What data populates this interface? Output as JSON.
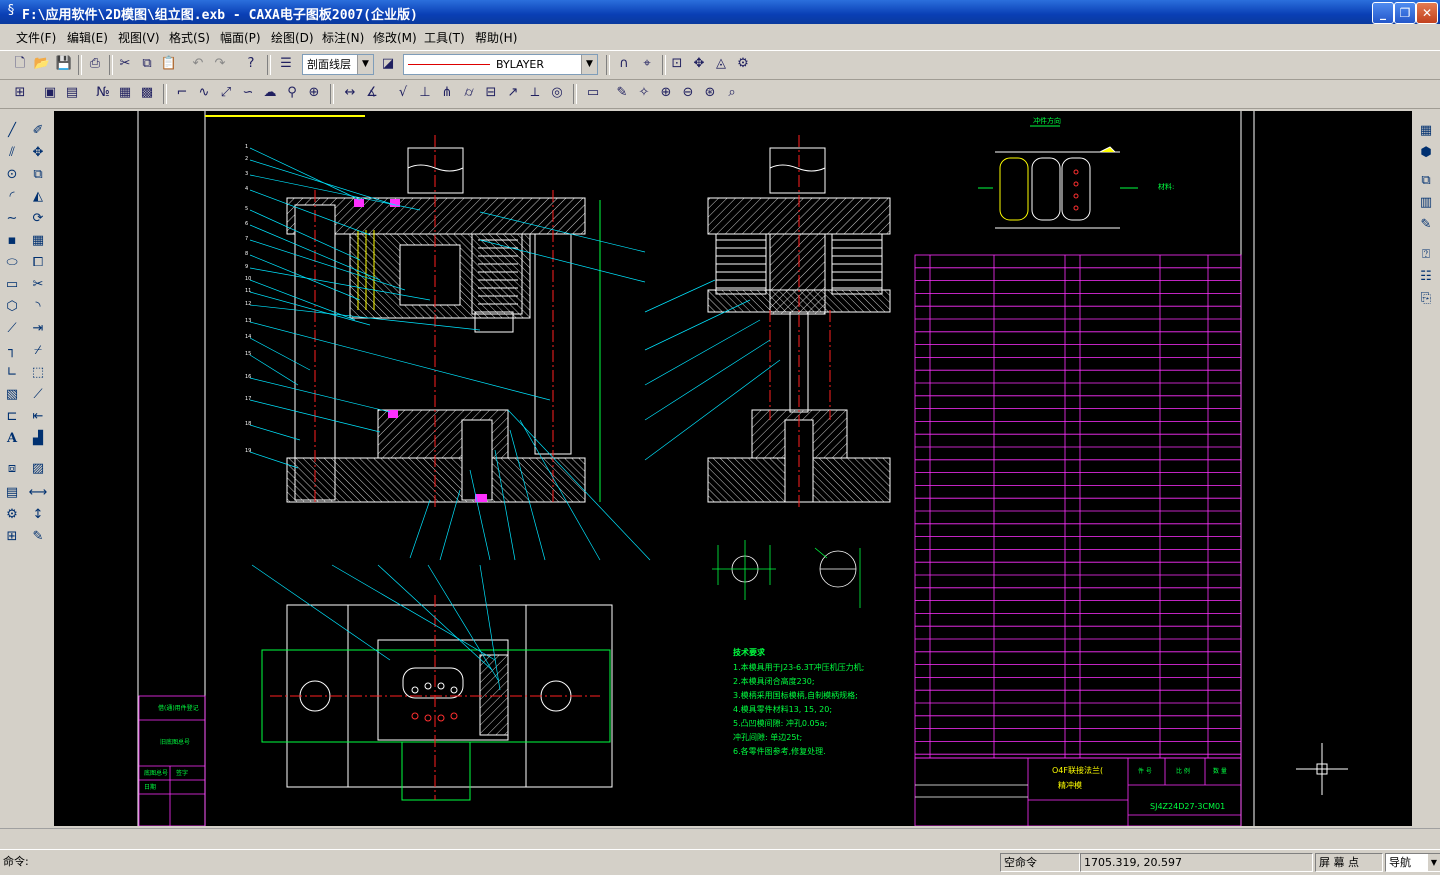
{
  "window": {
    "title": "F:\\应用软件\\2D模图\\组立图.exb - CAXA电子图板2007(企业版)",
    "minimize_glyph": "_",
    "restore_glyph": "❐",
    "close_glyph": "✕"
  },
  "menu": [
    "文件(F)",
    "编辑(E)",
    "视图(V)",
    "格式(S)",
    "幅面(P)",
    "绘图(D)",
    "标注(N)",
    "修改(M)",
    "工具(T)",
    "帮助(H)"
  ],
  "toolbar": {
    "layer_combo": "剖面线层",
    "linetype_combo": "BYLAYER"
  },
  "drawing": {
    "view_label": "冲件方向",
    "material_label": "材料:",
    "tech_requirements": [
      "技术要求",
      "1.本模具用于J23-6.3T冲压机压力机;",
      "2.本模具闭合高度230;",
      "3.模柄采用国标模柄,自制模柄规格;",
      "4.模具零件材料13, 15, 20;",
      "5.凸凹模间隙: 冲孔0.05a;",
      "  冲孔间隙: 单边25t;",
      "6.各零件图参考,修复处理."
    ],
    "left_tb_rows": [
      "借(通)用件登记",
      "旧底图总号",
      "底图总号",
      "签字",
      "日期"
    ],
    "title_block": {
      "name_line1": "O4F联接法兰(",
      "name_line2": "精冲模",
      "drawing_number": "SJ4Z24D27-3CM01",
      "cols": [
        "件 号",
        "比 例",
        "数 量"
      ]
    }
  },
  "status": {
    "command_label": "命令:",
    "mode": "空命令",
    "coordinates": "1705.319, 20.597",
    "screen_point": "屏 幕 点",
    "nav": "导航"
  },
  "colors": {
    "title_bar": "#0a3fb5",
    "canvas": "#000000",
    "white_line": "#ffffff",
    "red_center": "#ff2020",
    "cyan_leader": "#00e5ff",
    "green_text": "#00ff40",
    "magenta_table": "#ff30ff",
    "yellow": "#ffff00"
  }
}
